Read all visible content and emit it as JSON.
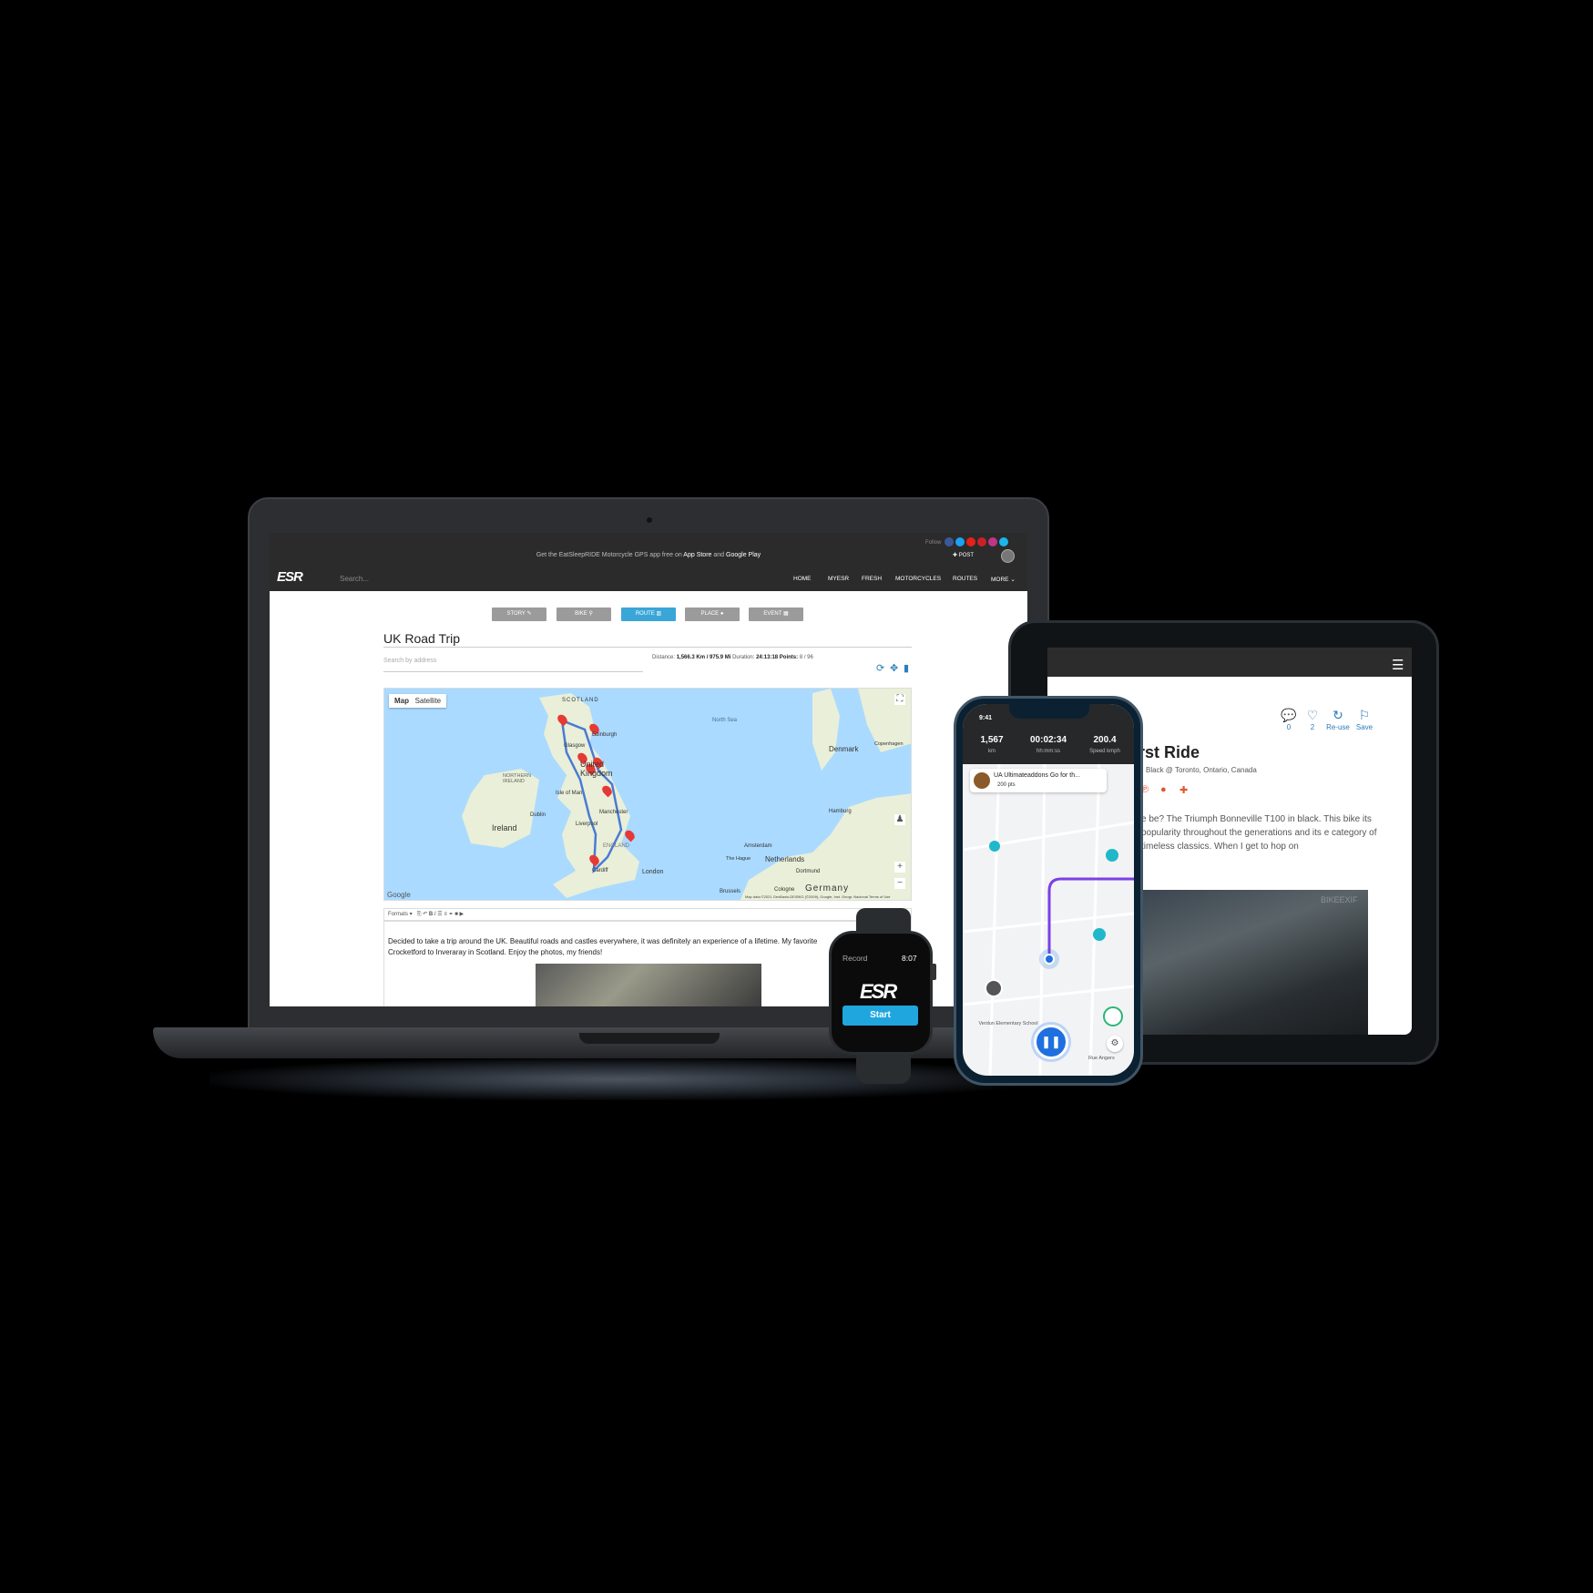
{
  "laptop": {
    "promo": {
      "prefix": "Get the EatSleepRIDE Motorcycle GPS app free on",
      "app_store": "App Store",
      "and": "and",
      "google_play": "Google Play"
    },
    "follow": "Follow",
    "post": "✚ POST",
    "logo": "ESR",
    "search_placeholder": "Search...",
    "nav": [
      "HOME",
      "MYESR",
      "FRESH",
      "MOTORCYCLES",
      "ROUTES",
      "MORE"
    ],
    "tabs": [
      "STORY",
      "BIKE",
      "ROUTE",
      "PLACE",
      "EVENT"
    ],
    "active_tab": "ROUTE",
    "title": "UK Road Trip",
    "address_placeholder": "Search by address",
    "stats": {
      "distance_label": "Distance:",
      "distance": "1,566.3 Km / 975.9 Mi",
      "duration_label": "Duration:",
      "duration": "24:13:18",
      "points_label": "Points:",
      "points": "8 / 96"
    },
    "map": {
      "toggle_map": "Map",
      "toggle_satellite": "Satellite",
      "labels": {
        "scotland": "SCOTLAND",
        "edinburgh": "Edinburgh",
        "glasgow": "Glasgow",
        "united_kingdom": "United Kingdom",
        "northern_ireland": "NORTHERN IRELAND",
        "ireland": "Ireland",
        "dublin": "Dublin",
        "isle_of_man": "Isle of Man",
        "manchester": "Manchester",
        "liverpool": "Liverpool",
        "england": "ENGLAND",
        "london": "London",
        "cardiff": "Cardiff",
        "denmark": "Denmark",
        "copenhagen": "Copenhagen",
        "hamburg": "Hamburg",
        "amsterdam": "Amsterdam",
        "netherlands": "Netherlands",
        "the_hague": "The Hague",
        "germany": "Germany",
        "dortmund": "Dortmund",
        "cologne": "Cologne",
        "brussels": "Brussels",
        "north_sea": "North Sea"
      },
      "google": "Google",
      "attribution": "Map data ©2021 GeoBasis-DE/BKG (©2009), Google, Inst. Geogr. Nacional   Terms of Use",
      "route_color": "#4a7bd4",
      "pin_color": "#e53935"
    },
    "editor": {
      "formats": "Formats",
      "text_line1": "Decided to take a trip around the UK. Beautiful roads and castles everywhere, it was definitely an experience of a lifetime. My favorite",
      "text_line2": "Crocketford to Inveraray in Scotland. Enjoy the photos, my friends!"
    }
  },
  "tablet": {
    "actions": [
      {
        "icon": "comment-icon",
        "label": "0"
      },
      {
        "icon": "heart-icon",
        "label": "2"
      },
      {
        "icon": "reuse-icon",
        "label": "Re-use"
      },
      {
        "icon": "bookmark-icon",
        "label": "Save"
      }
    ],
    "title": "irst Ride",
    "subtitle": "Black @ Toronto, Ontario, Canada",
    "body": "e be? The Triumph Bonneville T100 in black. This bike its popularity throughout the generations and its e category of timeless classics. When I get to hop on",
    "image_watermark": "BIKEEXIF"
  },
  "watch": {
    "label": "Record",
    "time": "8:07",
    "logo": "ESR",
    "start": "Start",
    "accent": "#20a6df"
  },
  "phone": {
    "time": "9:41",
    "stats": [
      {
        "value": "1,567",
        "unit": "km"
      },
      {
        "value": "00:02:34",
        "unit": "hh:mm:ss"
      },
      {
        "value": "200.4",
        "unit": "Speed kmph"
      }
    ],
    "card": {
      "title": "UA Ultimateaddons Go for th...",
      "points": "200 pts"
    },
    "map_labels": {
      "school": "Verdun Elementary School",
      "rue": "Rue Angers"
    },
    "route_color": "#7b3fe4"
  }
}
